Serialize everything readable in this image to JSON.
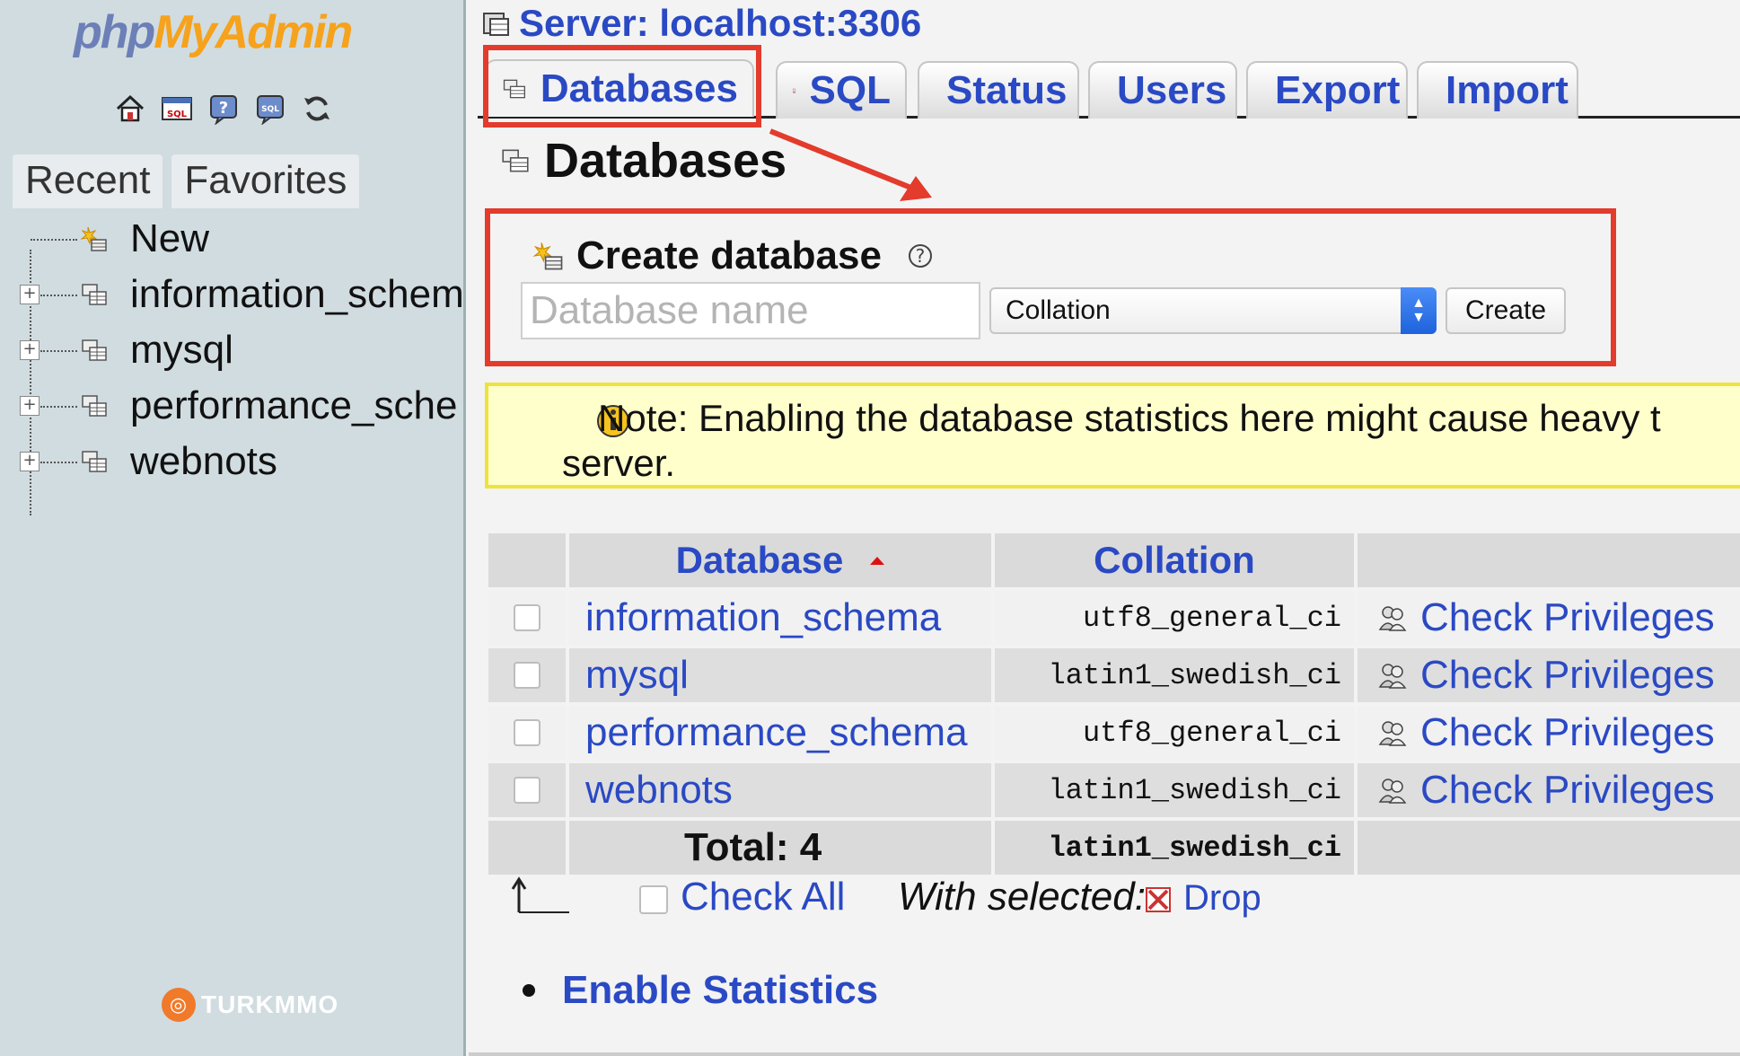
{
  "nav": {
    "logo": {
      "part1": "php",
      "part2": "MyAdmin"
    },
    "quick_icons": [
      "home-icon",
      "sql-query-icon",
      "help-icon",
      "sql-docs-icon",
      "refresh-icon"
    ],
    "tabs": {
      "recent": "Recent",
      "favorites": "Favorites"
    },
    "tree": [
      {
        "label": "New",
        "type": "new"
      },
      {
        "label": "information_schem",
        "type": "db"
      },
      {
        "label": "mysql",
        "type": "db"
      },
      {
        "label": "performance_sche",
        "type": "db"
      },
      {
        "label": "webnots",
        "type": "db"
      }
    ],
    "watermark": "TURKMMO"
  },
  "main": {
    "server": "Server: localhost:3306",
    "tabs": [
      {
        "label": "Databases",
        "icon": "database-icon",
        "active": true
      },
      {
        "label": "SQL",
        "icon": "sql-icon"
      },
      {
        "label": "Status",
        "icon": "status-icon"
      },
      {
        "label": "Users",
        "icon": "users-icon"
      },
      {
        "label": "Export",
        "icon": "export-icon"
      },
      {
        "label": "Import",
        "icon": "import-icon"
      }
    ],
    "page_title": "Databases",
    "create_db": {
      "title": "Create database",
      "name_placeholder": "Database name",
      "collation_value": "Collation",
      "create_label": "Create"
    },
    "note": {
      "line1": "Note: Enabling the database statistics here might cause heavy t",
      "line2": "server."
    },
    "table": {
      "headers": {
        "database": "Database",
        "collation": "Collation"
      },
      "rows": [
        {
          "name": "information_schema",
          "collation": "utf8_general_ci",
          "action": "Check Privileges"
        },
        {
          "name": "mysql",
          "collation": "latin1_swedish_ci",
          "action": "Check Privileges"
        },
        {
          "name": "performance_schema",
          "collation": "utf8_general_ci",
          "action": "Check Privileges"
        },
        {
          "name": "webnots",
          "collation": "latin1_swedish_ci",
          "action": "Check Privileges"
        }
      ],
      "total_label": "Total: 4",
      "total_collation": "latin1_swedish_ci"
    },
    "bulk": {
      "check_all": "Check All",
      "with_selected": "With selected:",
      "drop": "Drop"
    },
    "enable_stats": "Enable Statistics"
  },
  "colors": {
    "link": "#2a49c4",
    "highlight": "#e33b2c",
    "nav_bg": "#d0dce0",
    "note_bg": "#ffffcc",
    "logo_accent": "#f6a21c"
  }
}
